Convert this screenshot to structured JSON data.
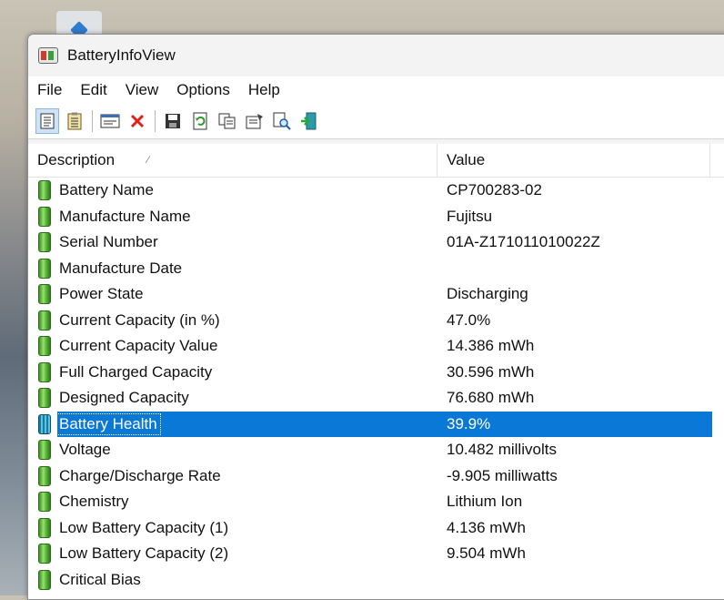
{
  "window": {
    "title": "BatteryInfoView"
  },
  "menu": [
    "File",
    "Edit",
    "View",
    "Options",
    "Help"
  ],
  "toolbar": {
    "buttons": [
      {
        "name": "details-view-icon"
      },
      {
        "name": "clipboard-view-icon"
      },
      {
        "name": "properties-window-icon"
      },
      {
        "name": "delete-icon"
      },
      {
        "name": "save-icon"
      },
      {
        "name": "refresh-icon"
      },
      {
        "name": "copy-icon"
      },
      {
        "name": "properties-icon"
      },
      {
        "name": "find-icon"
      },
      {
        "name": "exit-icon"
      }
    ]
  },
  "columns": {
    "description": "Description",
    "value": "Value"
  },
  "rows": [
    {
      "description": "Battery Name",
      "value": "CP700283-02"
    },
    {
      "description": "Manufacture Name",
      "value": "Fujitsu"
    },
    {
      "description": "Serial Number",
      "value": "01A-Z171011010022Z"
    },
    {
      "description": "Manufacture Date",
      "value": ""
    },
    {
      "description": "Power State",
      "value": "Discharging"
    },
    {
      "description": "Current Capacity (in %)",
      "value": "47.0%"
    },
    {
      "description": "Current Capacity Value",
      "value": "14.386 mWh"
    },
    {
      "description": "Full Charged Capacity",
      "value": "30.596 mWh"
    },
    {
      "description": "Designed Capacity",
      "value": "76.680 mWh"
    },
    {
      "description": "Battery Health",
      "value": "39.9%",
      "selected": true
    },
    {
      "description": "Voltage",
      "value": "10.482 millivolts"
    },
    {
      "description": "Charge/Discharge Rate",
      "value": "-9.905 milliwatts"
    },
    {
      "description": "Chemistry",
      "value": "Lithium Ion"
    },
    {
      "description": "Low Battery Capacity (1)",
      "value": "4.136 mWh"
    },
    {
      "description": "Low Battery Capacity (2)",
      "value": "9.504 mWh"
    },
    {
      "description": "Critical Bias",
      "value": ""
    }
  ],
  "colors": {
    "selection": "#0a78d7",
    "battery_icon": "#3e8e24"
  }
}
